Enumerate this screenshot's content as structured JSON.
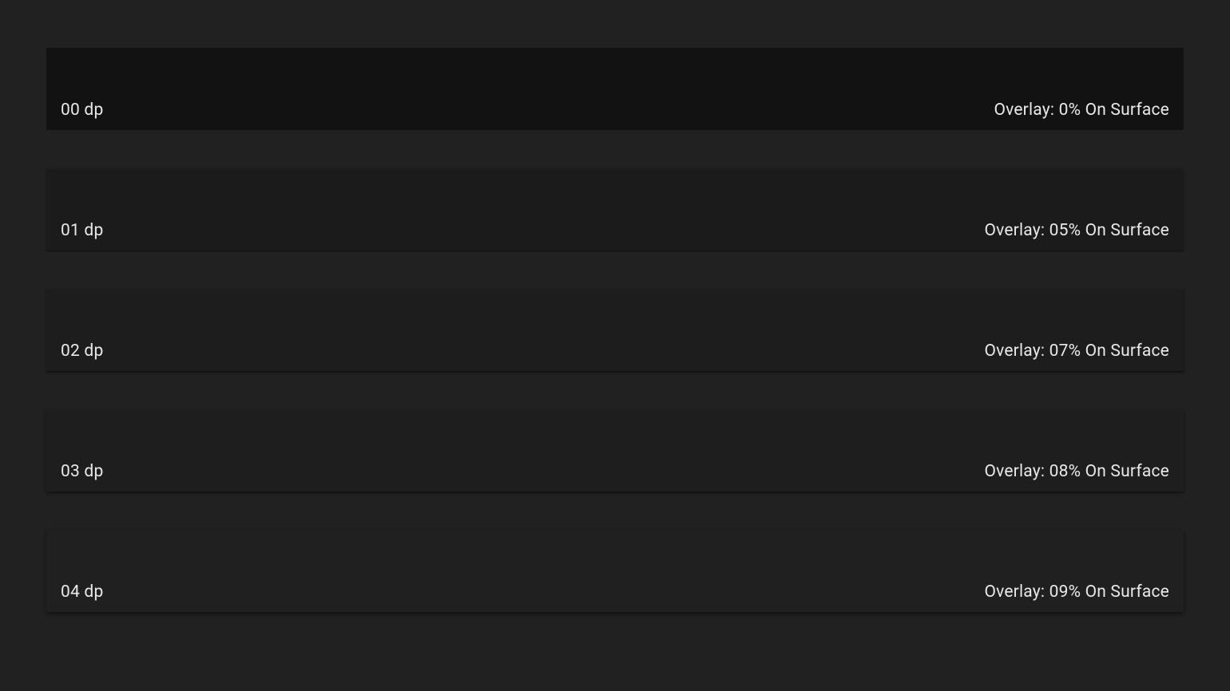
{
  "rows": [
    {
      "elevation": "00 dp",
      "overlay": "Overlay: 0% On Surface"
    },
    {
      "elevation": "01 dp",
      "overlay": "Overlay: 05% On Surface"
    },
    {
      "elevation": "02 dp",
      "overlay": "Overlay: 07% On Surface"
    },
    {
      "elevation": "03 dp",
      "overlay": "Overlay: 08% On Surface"
    },
    {
      "elevation": "04 dp",
      "overlay": "Overlay: 09% On Surface"
    }
  ]
}
